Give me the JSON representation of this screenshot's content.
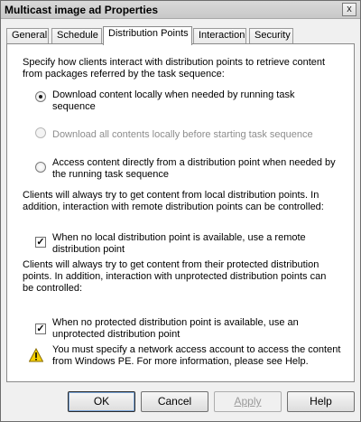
{
  "window": {
    "title": "Multicast  image ad Properties",
    "close_glyph": "x"
  },
  "tabs": [
    {
      "label": "General"
    },
    {
      "label": "Schedule"
    },
    {
      "label": "Distribution Points"
    },
    {
      "label": "Interaction"
    },
    {
      "label": "Security"
    }
  ],
  "active_tab": "Distribution Points",
  "panel": {
    "intro": "Specify how clients interact with distribution points to retrieve content from packages referred by the task sequence:",
    "radio_download_locally": {
      "line1": "Download content locally when needed by running task",
      "line2": "sequence",
      "checked": true
    },
    "radio_download_all": {
      "label": "Download all contents locally before starting task sequence",
      "enabled": false
    },
    "radio_access_directly": {
      "line1": "Access content directly from a distribution point when needed by",
      "line2": "the running task sequence",
      "checked": false
    },
    "local_dp_text": {
      "line1": "Clients will always try to get content from local distribution points. In",
      "line2": "addition, interaction with remote distribution points can be controlled:"
    },
    "check_remote_dp": {
      "line1": "When no local distribution point is available, use a remote",
      "line2": "distribution point",
      "checked": true
    },
    "protected_dp_text": {
      "line1": "Clients will always try to get content from their protected distribution",
      "line2": "points. In addition, interaction with unprotected distribution points can",
      "line3": "be controlled:"
    },
    "check_unprotected_dp": {
      "line1": "When no protected distribution point is available, use an",
      "line2": "unprotected distribution point",
      "checked": true
    },
    "warning": {
      "icon": "warning-icon",
      "line1": "You must specify a network access account to access the content",
      "line2": "from Windows PE.  For more information, please see Help."
    }
  },
  "buttons": {
    "ok": "OK",
    "cancel": "Cancel",
    "apply": "Apply",
    "help": "Help"
  },
  "check_glyph": "✓"
}
